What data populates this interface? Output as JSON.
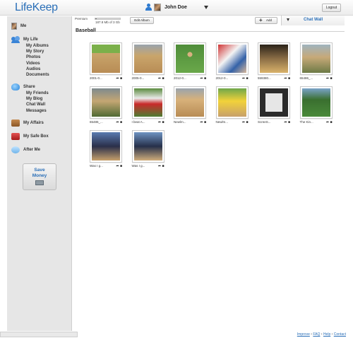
{
  "app": {
    "logo": "LifeKeep"
  },
  "header": {
    "user_name": "John Doe",
    "logout_label": "Logout"
  },
  "sidebar": {
    "me": "Me",
    "my_life": {
      "label": "My Life",
      "items": [
        "My Albums",
        "My Story",
        "Photos",
        "Videos",
        "Audios",
        "Documents"
      ]
    },
    "share": {
      "label": "Share",
      "items": [
        "My Friends",
        "My Blog",
        "Chat Wall",
        "Messages"
      ]
    },
    "my_affairs": "My Affairs",
    "my_safe_box": "My Safe Box",
    "after_me": "After Me",
    "save_money": {
      "line1": "Save",
      "line2": "Money"
    }
  },
  "toolbar": {
    "premium_label": "Premium",
    "quota_text": "187.8 Mb of 3 Gb",
    "quota_fraction": 0.06,
    "edit_album_label": "Edit Album",
    "add_label": "Add"
  },
  "chat_wall": {
    "label": "Chat Wall"
  },
  "album": {
    "title": "Baseball",
    "photos": [
      {
        "name": "2001-0...",
        "style": "img-a"
      },
      {
        "name": "2005-0...",
        "style": "img-b"
      },
      {
        "name": "2012-0...",
        "style": "img-c"
      },
      {
        "name": "2012-0...",
        "style": "img-d"
      },
      {
        "name": "559380...",
        "style": "img-e"
      },
      {
        "name": "65486_...",
        "style": "img-f"
      },
      {
        "name": "65486_...",
        "style": "img-g"
      },
      {
        "name": "I beat A...",
        "style": "img-h"
      },
      {
        "name": "Newlm...",
        "style": "img-i"
      },
      {
        "name": "Newlm...",
        "style": "img-j"
      },
      {
        "name": "ScreeS...",
        "style": "img-k"
      },
      {
        "name": "The Kin...",
        "style": "img-l"
      },
      {
        "name": "Was I g...",
        "style": "img-m"
      },
      {
        "name": "Was I g...",
        "style": "img-n"
      }
    ]
  },
  "footer": {
    "links": [
      "Improve",
      "FAQ",
      "Help",
      "Contact"
    ]
  },
  "colors": {
    "brand": "#2a6fb8"
  }
}
